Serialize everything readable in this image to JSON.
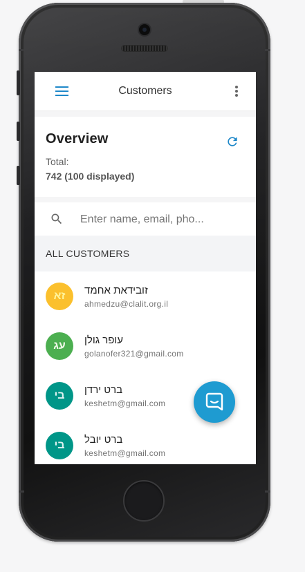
{
  "app": {
    "title": "Customers"
  },
  "overview": {
    "title": "Overview",
    "total_label": "Total:",
    "total_value": "742 (100 displayed)"
  },
  "search": {
    "placeholder": "Enter name, email, pho..."
  },
  "section": {
    "title": "ALL CUSTOMERS"
  },
  "customers": [
    {
      "initials": "זא",
      "name": "זובידאת אחמד",
      "email": "ahmedzu@clalit.org.il",
      "avatar_color": "#fbc02d",
      "initials_color": "#fff59d"
    },
    {
      "initials": "עג",
      "name": "עופר גולן",
      "email": "golanofer321@gmail.com",
      "avatar_color": "#4caf50",
      "initials_color": "#f1f8e9"
    },
    {
      "initials": "בי",
      "name": "ברט ירדן",
      "email": "keshetm@gmail.com",
      "avatar_color": "#009688",
      "initials_color": "#e0f2f1"
    },
    {
      "initials": "בי",
      "name": "ברט יובל",
      "email": "keshetm@gmail.com",
      "avatar_color": "#009688",
      "initials_color": "#e0f2f1"
    }
  ],
  "icons": {
    "menu": "menu-icon",
    "more": "more-vert-icon",
    "refresh": "refresh-icon",
    "search": "search-icon",
    "chat": "chat-icon"
  },
  "colors": {
    "accent": "#1e88c9",
    "fab": "#1e9bd1"
  }
}
